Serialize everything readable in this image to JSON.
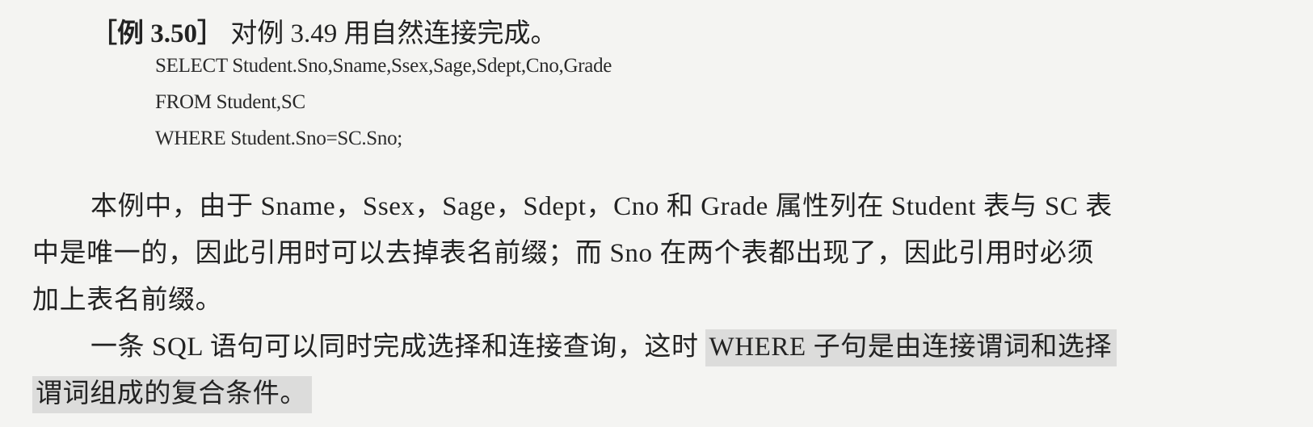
{
  "example": {
    "label": "［例 3.50］",
    "title": "对例 3.49 用自然连接完成。"
  },
  "code": [
    "SELECT Student.Sno,Sname,Ssex,Sage,Sdept,Cno,Grade",
    "FROM Student,SC",
    "WHERE Student.Sno=SC.Sno;"
  ],
  "paragraph1": [
    "本例中，由于 Sname，Ssex，Sage，Sdept，Cno 和 Grade 属性列在 Student 表与 SC 表",
    "中是唯一的，因此引用时可以去掉表名前缀；而 Sno 在两个表都出现了，因此引用时必须",
    "加上表名前缀。"
  ],
  "paragraph2": {
    "line1_plain": "一条 SQL 语句可以同时完成选择和连接查询，这时 ",
    "line1_highlight": "WHERE 子句是由连接谓词和选择",
    "line2_highlight": "谓词组成的复合条件。"
  },
  "colors": {
    "highlight": "#dcdcdb",
    "paper": "#f4f4f2",
    "text": "#222222"
  }
}
